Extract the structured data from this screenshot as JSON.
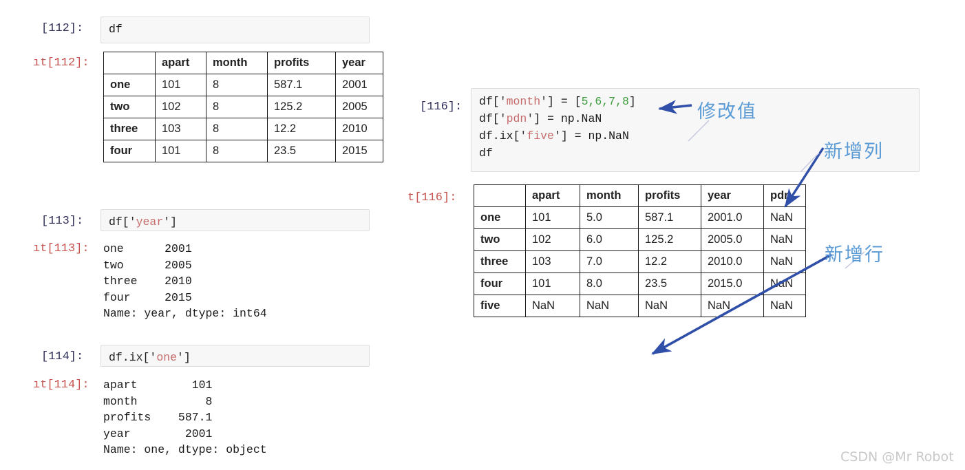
{
  "notebook": {
    "left_cells": [
      {
        "in_label": "[112]:",
        "out_label": "ıt[112]:",
        "code": "df"
      },
      {
        "in_label": "[113]:",
        "out_label": "ıt[113]:",
        "code_prefix": "df[",
        "code_quote_open": "'",
        "code_string": "year",
        "code_quote_close": "'",
        "code_suffix": "]",
        "output_text": "one      2001\ntwo      2005\nthree    2010\nfour     2015\nName: year, dtype: int64"
      },
      {
        "in_label": "[114]:",
        "out_label": "ıt[114]:",
        "code_prefix": "df.ix[",
        "code_quote_open": "'",
        "code_string": "one",
        "code_quote_close": "'",
        "code_suffix": "]",
        "output_text": "apart        101\nmonth          8\nprofits    587.1\nyear        2001\nName: one, dtype: object"
      }
    ],
    "right_cell": {
      "in_label": "[116]:",
      "out_label": "t[116]:",
      "code_lines": [
        {
          "pre": "df[",
          "q1": "'",
          "str": "month",
          "q2": "'",
          "mid": "] = [",
          "num": "5,6,7,8",
          "post": "]"
        },
        {
          "pre": "df[",
          "q1": "'",
          "str": "pdn",
          "q2": "'",
          "mid": "] = np.NaN",
          "num": "",
          "post": ""
        },
        {
          "pre": "df.ix[",
          "q1": "'",
          "str": "five",
          "q2": "'",
          "mid": "] = np.NaN",
          "num": "",
          "post": ""
        },
        {
          "pre": "df",
          "q1": "",
          "str": "",
          "q2": "",
          "mid": "",
          "num": "",
          "post": ""
        }
      ]
    }
  },
  "table_112": {
    "columns": [
      "",
      "apart",
      "month",
      "profits",
      "year"
    ],
    "rows": [
      {
        "index": "one",
        "cells": [
          "101",
          "8",
          "587.1",
          "2001"
        ]
      },
      {
        "index": "two",
        "cells": [
          "102",
          "8",
          "125.2",
          "2005"
        ]
      },
      {
        "index": "three",
        "cells": [
          "103",
          "8",
          "12.2",
          "2010"
        ]
      },
      {
        "index": "four",
        "cells": [
          "101",
          "8",
          "23.5",
          "2015"
        ]
      }
    ]
  },
  "table_116": {
    "columns": [
      "",
      "apart",
      "month",
      "profits",
      "year",
      "pdn"
    ],
    "rows": [
      {
        "index": "one",
        "cells": [
          "101",
          "5.0",
          "587.1",
          "2001.0",
          "NaN"
        ]
      },
      {
        "index": "two",
        "cells": [
          "102",
          "6.0",
          "125.2",
          "2005.0",
          "NaN"
        ]
      },
      {
        "index": "three",
        "cells": [
          "103",
          "7.0",
          "12.2",
          "2010.0",
          "NaN"
        ]
      },
      {
        "index": "four",
        "cells": [
          "101",
          "8.0",
          "23.5",
          "2015.0",
          "NaN"
        ]
      },
      {
        "index": "five",
        "cells": [
          "NaN",
          "NaN",
          "NaN",
          "NaN",
          "NaN"
        ]
      }
    ]
  },
  "annotations": [
    {
      "id": "modify-value",
      "text": "修改值"
    },
    {
      "id": "new-column",
      "text": "新增列"
    },
    {
      "id": "new-row",
      "text": "新增行"
    }
  ],
  "watermark": {
    "text": "CSDN @Mr Robot"
  },
  "colors": {
    "annotation_text": "#5b9bd5",
    "arrow": "#2f4fa8",
    "in_prompt": "#30305a",
    "out_prompt": "#c75450",
    "code_string": "#c76b6b",
    "code_number": "#3f9b3f",
    "cell_bg": "#f7f7f7"
  }
}
